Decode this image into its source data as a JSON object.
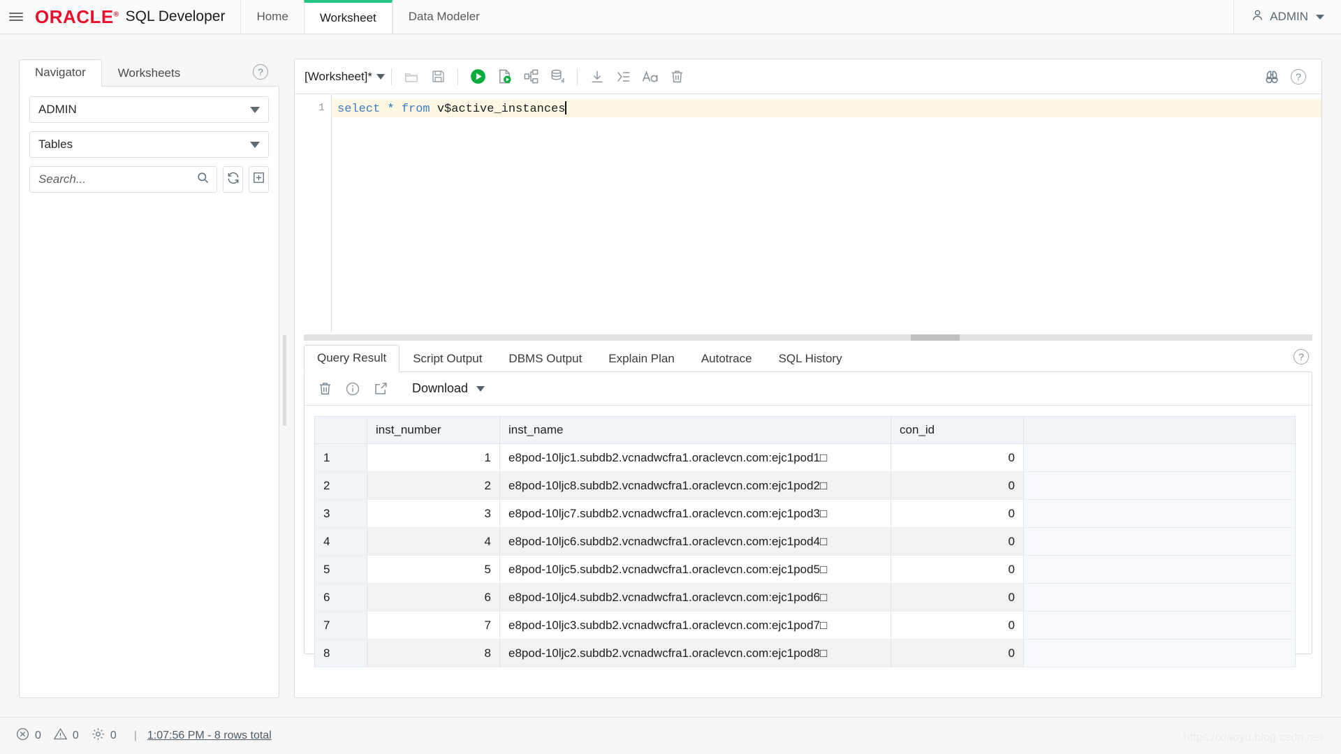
{
  "topbar": {
    "menu_icon": "hamburger-icon",
    "logo_text": "ORACLE",
    "logo_mark": "®",
    "product_name": "SQL Developer",
    "tabs": [
      {
        "label": "Home",
        "active": false
      },
      {
        "label": "Worksheet",
        "active": true
      },
      {
        "label": "Data Modeler",
        "active": false
      }
    ],
    "user": {
      "name": "ADMIN",
      "icon": "person-icon",
      "caret": "chevron-down-icon"
    },
    "accent_green": "#25c685",
    "oracle_red": "#e8112d"
  },
  "sidebar": {
    "tabs": [
      {
        "label": "Navigator",
        "active": true
      },
      {
        "label": "Worksheets",
        "active": false
      }
    ],
    "help_icon": "help-circle-icon",
    "schema_select": {
      "value": "ADMIN"
    },
    "object_type_select": {
      "value": "Tables"
    },
    "search": {
      "placeholder": "Search...",
      "value": "",
      "icon": "search-icon"
    },
    "refresh_button": {
      "icon": "refresh-icon"
    },
    "new_object_button": {
      "icon": "plus-box-icon"
    }
  },
  "worksheet": {
    "name": "[Worksheet]*",
    "name_caret": "chevron-down-icon",
    "toolbar": [
      {
        "name": "open-file-button",
        "icon": "folder-icon",
        "title": "Open"
      },
      {
        "name": "save-button",
        "icon": "floppy-disk-icon",
        "title": "Save"
      },
      {
        "name": "run-statement-button",
        "icon": "run-play-icon",
        "title": "Run Statement"
      },
      {
        "name": "run-script-button",
        "icon": "run-script-icon",
        "title": "Run Script"
      },
      {
        "name": "explain-plan-button",
        "icon": "explain-plan-icon",
        "title": "Explain Plan"
      },
      {
        "name": "autotrace-button",
        "icon": "autotrace-db-icon",
        "title": "Autotrace"
      },
      {
        "name": "download-sql-button",
        "icon": "download-arrow-icon",
        "title": "Download"
      },
      {
        "name": "format-button",
        "icon": "format-indent-icon",
        "title": "Format"
      },
      {
        "name": "font-size-button",
        "icon": "font-aa-icon",
        "title": "Font Size"
      },
      {
        "name": "clear-button",
        "icon": "trash-icon",
        "title": "Clear"
      }
    ],
    "find_button": {
      "icon": "binoculars-icon"
    },
    "help_button": {
      "icon": "help-circle-icon"
    },
    "editor": {
      "line_number": "1",
      "code_keyword_1": "select",
      "code_star": "*",
      "code_keyword_2": "from",
      "code_identifier": "v$active_instances",
      "full_text": "select * from v$active_instances"
    }
  },
  "results": {
    "tabs": [
      {
        "label": "Query Result",
        "active": true
      },
      {
        "label": "Script Output",
        "active": false
      },
      {
        "label": "DBMS Output",
        "active": false
      },
      {
        "label": "Explain Plan",
        "active": false
      },
      {
        "label": "Autotrace",
        "active": false
      },
      {
        "label": "SQL History",
        "active": false
      }
    ],
    "help_icon": "help-circle-icon",
    "toolbar": {
      "clear_button": {
        "icon": "trash-icon"
      },
      "info_button": {
        "icon": "info-circle-icon"
      },
      "popout_button": {
        "icon": "external-link-icon"
      },
      "download_label": "Download",
      "download_caret": "chevron-down-icon"
    },
    "grid": {
      "columns": [
        "",
        "inst_number",
        "inst_name",
        "con_id"
      ],
      "rows": [
        {
          "n": "1",
          "inst_number": "1",
          "inst_name": "e8pod-10ljc1.subdb2.vcnadwcfra1.oraclevcn.com:ejc1pod1□",
          "con_id": "0"
        },
        {
          "n": "2",
          "inst_number": "2",
          "inst_name": "e8pod-10ljc8.subdb2.vcnadwcfra1.oraclevcn.com:ejc1pod2□",
          "con_id": "0"
        },
        {
          "n": "3",
          "inst_number": "3",
          "inst_name": "e8pod-10ljc7.subdb2.vcnadwcfra1.oraclevcn.com:ejc1pod3□",
          "con_id": "0"
        },
        {
          "n": "4",
          "inst_number": "4",
          "inst_name": "e8pod-10ljc6.subdb2.vcnadwcfra1.oraclevcn.com:ejc1pod4□",
          "con_id": "0"
        },
        {
          "n": "5",
          "inst_number": "5",
          "inst_name": "e8pod-10ljc5.subdb2.vcnadwcfra1.oraclevcn.com:ejc1pod5□",
          "con_id": "0"
        },
        {
          "n": "6",
          "inst_number": "6",
          "inst_name": "e8pod-10ljc4.subdb2.vcnadwcfra1.oraclevcn.com:ejc1pod6□",
          "con_id": "0"
        },
        {
          "n": "7",
          "inst_number": "7",
          "inst_name": "e8pod-10ljc3.subdb2.vcnadwcfra1.oraclevcn.com:ejc1pod7□",
          "con_id": "0"
        },
        {
          "n": "8",
          "inst_number": "8",
          "inst_name": "e8pod-10ljc2.subdb2.vcnadwcfra1.oraclevcn.com:ejc1pod8□",
          "con_id": "0"
        }
      ]
    }
  },
  "statusbar": {
    "error_icon": "error-circle-icon",
    "error_count": "0",
    "warning_icon": "warning-triangle-icon",
    "warning_count": "0",
    "settings_icon": "gear-icon",
    "settings_count": "0",
    "divider": "|",
    "message": "1:07:56 PM - 8 rows total"
  },
  "watermark": {
    "text": "https://xiaoyu.blog.csdn.net"
  }
}
